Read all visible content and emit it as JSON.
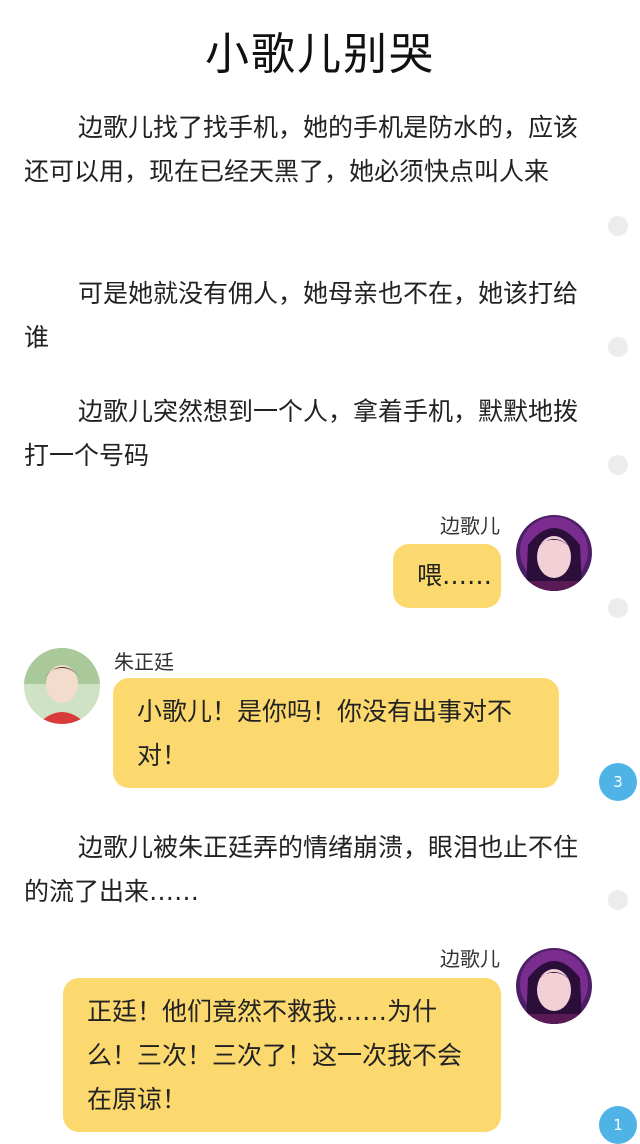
{
  "title": "小歌儿别哭",
  "paragraphs": {
    "p1": "边歌儿找了找手机，她的手机是防水的，应该还可以用，现在已经天黑了，她必须快点叫人来",
    "p2": "可是她就没有佣人，她母亲也不在，她该打给谁",
    "p3": "边歌儿突然想到一个人，拿着手机，默默地拨打一个号码",
    "p4": "边歌儿被朱正廷弄的情绪崩溃，眼泪也止不住的流了出来……"
  },
  "messages": {
    "m1": {
      "speaker": "边歌儿",
      "text": "喂……"
    },
    "m2": {
      "speaker": "朱正廷",
      "text": "小歌儿！是你吗！你没有出事对不对！"
    },
    "m3": {
      "speaker": "边歌儿",
      "text": "正廷！他们竟然不救我……为什么！三次！三次了！这一次我不会在原谅！"
    }
  },
  "badges": {
    "b1": "3",
    "b2": "1"
  },
  "colors": {
    "bubble": "#fcd96e",
    "badge": "#4fb3e6",
    "dot": "#ececec"
  }
}
